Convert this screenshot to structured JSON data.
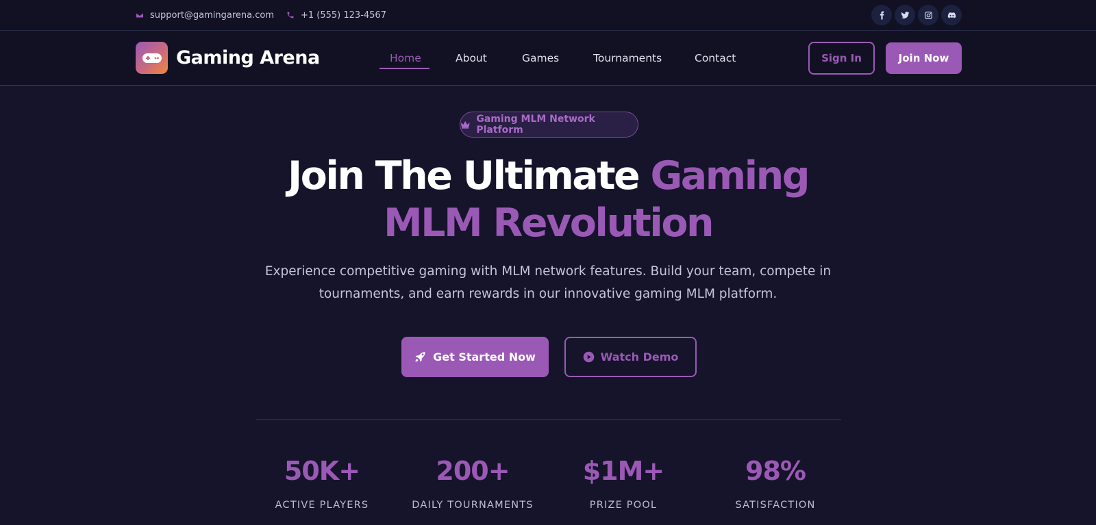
{
  "topbar": {
    "email": "support@gamingarena.com",
    "phone": "+1 (555) 123-4567",
    "social": [
      {
        "icon": "facebook-icon"
      },
      {
        "icon": "twitter-icon"
      },
      {
        "icon": "instagram-icon"
      },
      {
        "icon": "discord-icon"
      }
    ]
  },
  "navbar": {
    "brand": "Gaming Arena",
    "links": [
      "Home",
      "About",
      "Games",
      "Tournaments",
      "Contact"
    ],
    "active": "Home",
    "signin_label": "Sign In",
    "join_label": "Join Now"
  },
  "hero": {
    "badge": "Gaming MLM Network Platform",
    "title_white": "Join The Ultimate ",
    "title_accent": "Gaming",
    "title_line2": "MLM Revolution",
    "subtitle_line1": "Experience competitive gaming with MLM network features. Build your team, compete in",
    "subtitle_line2": "tournaments, and earn rewards in our innovative gaming MLM platform.",
    "primary_cta": "Get Started Now",
    "secondary_cta": "Watch Demo"
  },
  "stats": [
    {
      "value": "50K+",
      "label": "ACTIVE PLAYERS"
    },
    {
      "value": "200+",
      "label": "DAILY TOURNAMENTS"
    },
    {
      "value": "$1M+",
      "label": "PRIZE POOL"
    },
    {
      "value": "98%",
      "label": "SATISFACTION"
    }
  ],
  "colors": {
    "accent": "#9b59b6",
    "background": "#15142a",
    "bar": "#121123"
  }
}
